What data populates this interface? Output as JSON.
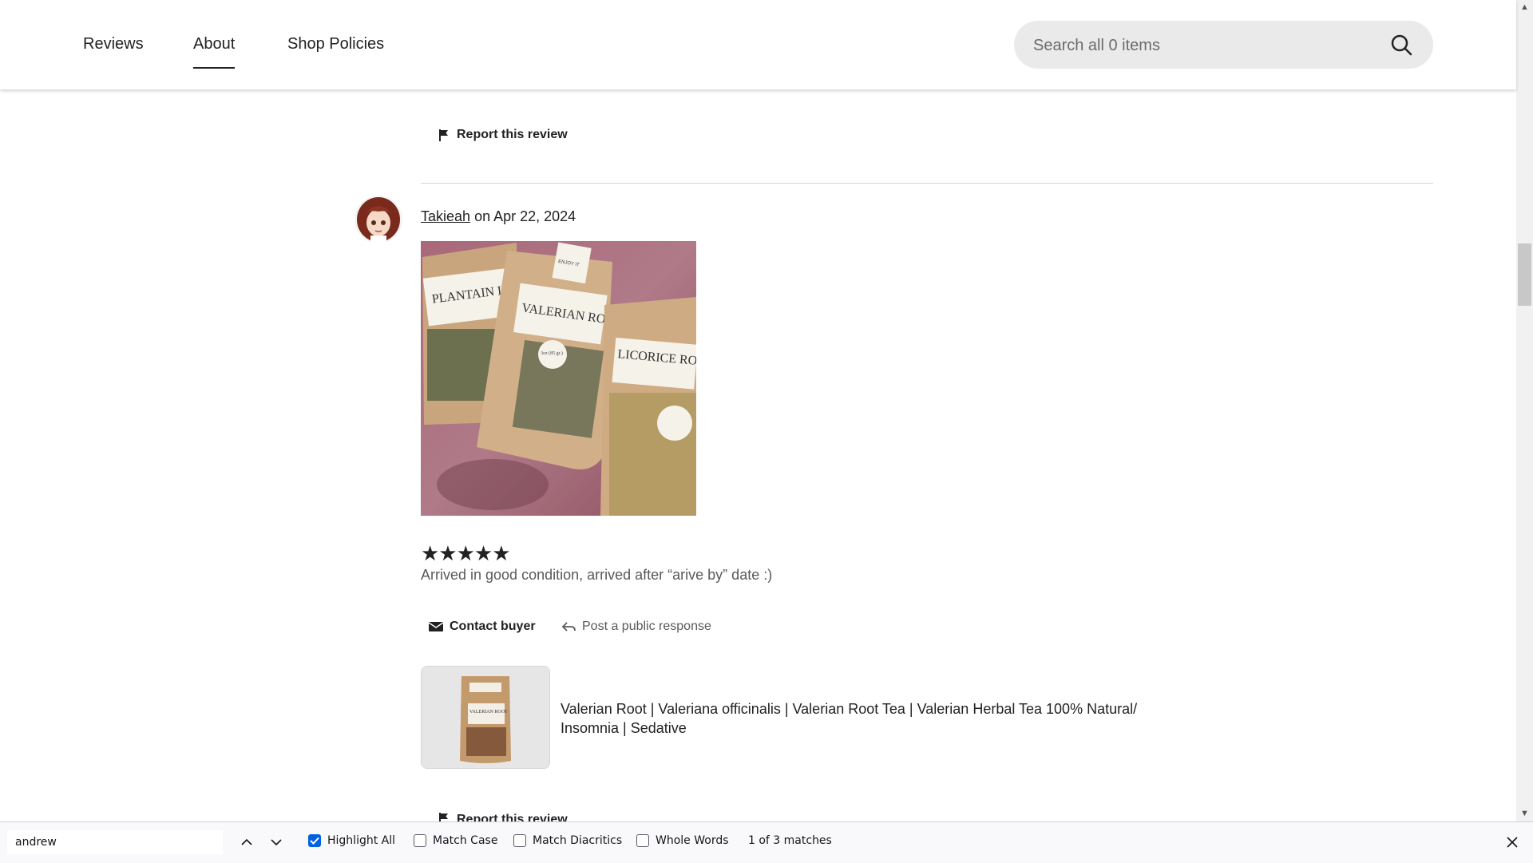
{
  "nav": {
    "tabs": [
      {
        "label": "Reviews"
      },
      {
        "label": "About"
      },
      {
        "label": "Shop Policies"
      }
    ],
    "active_tab": "About",
    "search": {
      "placeholder": "Search all 0 items",
      "icon": "search-icon"
    }
  },
  "previous_review": {
    "report_label": "Report this review",
    "icon": "flag-icon"
  },
  "review": {
    "reviewer": "Takieah",
    "date_text": "on Apr 22, 2024",
    "rating": 5,
    "rating_max": 5,
    "stars_text": "★★★★★",
    "text": "Arrived in good condition, arrived after “arive by” date :)",
    "photo_labels": {
      "plantain": "PLANTAIN LEAF",
      "valerian": "VALERIAN ROOT",
      "licorice": "LICORICE ROOT",
      "enjoy": "ENJOY IT",
      "weight": "3oz (85 gr.)"
    },
    "actions": {
      "contact": "Contact buyer",
      "respond": "Post a public response"
    },
    "product": {
      "title": "Valerian Root | Valeriana officinalis | Valerian Root Tea | Valerian Herbal Tea 100% Natural/ Insomnia | Sedative",
      "thumb_label": "VALERIAN ROOT"
    },
    "report_label": "Report this review"
  },
  "findbar": {
    "query": "andrew",
    "highlight_all": {
      "label": "Highlight All",
      "checked": true
    },
    "match_case": {
      "label": "Match Case",
      "checked": false
    },
    "match_diacritics": {
      "label": "Match Diacritics",
      "checked": false
    },
    "whole_words": {
      "label": "Whole Words",
      "checked": false
    },
    "match_status": "1 of 3 matches"
  },
  "colors": {
    "text": "#222222",
    "muted": "#595959",
    "accent_check": "#0061e0",
    "search_bg": "#eaeaea"
  }
}
